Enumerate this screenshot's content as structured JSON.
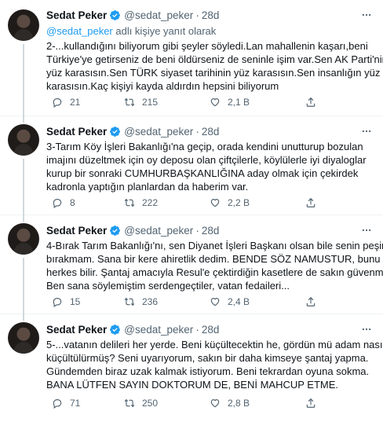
{
  "reply_context": {
    "prefix_link": "@sedat_peker",
    "suffix": " adlı kişiye yanıt olarak"
  },
  "tweets": [
    {
      "name": "Sedat Peker",
      "handle": "@sedat_peker",
      "time": "28d",
      "lines": [
        "2-...kullandığını biliyorum gibi şeyler söyledi.Lan mahallenin kaşarı,beni",
        "Türkiye'ye getirseniz de beni öldürseniz de seninle işim var.Sen AK Parti'nin",
        "yüz karasısın.Sen TÜRK siyaset tarihinin yüz karasısın.Sen insanlığın yüz",
        "karasısın.Kaç kişiyi kayda aldırdın hepsini biliyorum"
      ],
      "replies": "21",
      "retweets": "215",
      "likes": "2,1 B"
    },
    {
      "name": "Sedat Peker",
      "handle": "@sedat_peker",
      "time": "28d",
      "lines": [
        "3-Tarım Köy İşleri Bakanlığı'na geçip, orada kendini unutturup bozulan",
        "imajını düzeltmek için oy deposu olan çiftçilerle, köylülerle iyi diyaloglar",
        "kurup bir sonraki CUMHURBAŞKANLIĞINA aday olmak için çekirdek",
        "kadronla yaptığın planlardan da haberim var."
      ],
      "replies": "8",
      "retweets": "222",
      "likes": "2,2 B"
    },
    {
      "name": "Sedat Peker",
      "handle": "@sedat_peker",
      "time": "28d",
      "lines": [
        "4-Bırak Tarım Bakanlığı'nı, sen Diyanet İşleri Başkanı olsan bile senin peşini",
        "bırakmam. Sana bir kere ahiretlik dedim. BENDE SÖZ NAMUSTUR, bunu",
        "herkes bilir. Şantaj amacıyla Resul'e çektirdiğin kasetlere de sakın güvenme.",
        "Ben sana söylemiştim serdengeçtiler, vatan fedaileri..."
      ],
      "replies": "15",
      "retweets": "236",
      "likes": "2,4 B"
    },
    {
      "name": "Sedat Peker",
      "handle": "@sedat_peker",
      "time": "28d",
      "lines": [
        "5-...vatanın delileri her yerde. Beni küçültecektin he, gördün mü adam nasıl",
        "küçültülürmüş? Seni uyarıyorum, sakın bir daha kimseye şantaj yapma.",
        "Gündemden biraz uzak kalmak istiyorum. Beni tekrardan oyuna sokma.",
        "BANA LÜTFEN SAYIN DOKTORUM DE, BENİ MAHCUP ETME."
      ],
      "replies": "71",
      "retweets": "250",
      "likes": "2,8 B"
    }
  ],
  "colors": {
    "accent": "#1d9bf0",
    "text": "#0f1419",
    "muted": "#536471",
    "divider": "#eff3f4",
    "thread": "#cfd9de"
  }
}
